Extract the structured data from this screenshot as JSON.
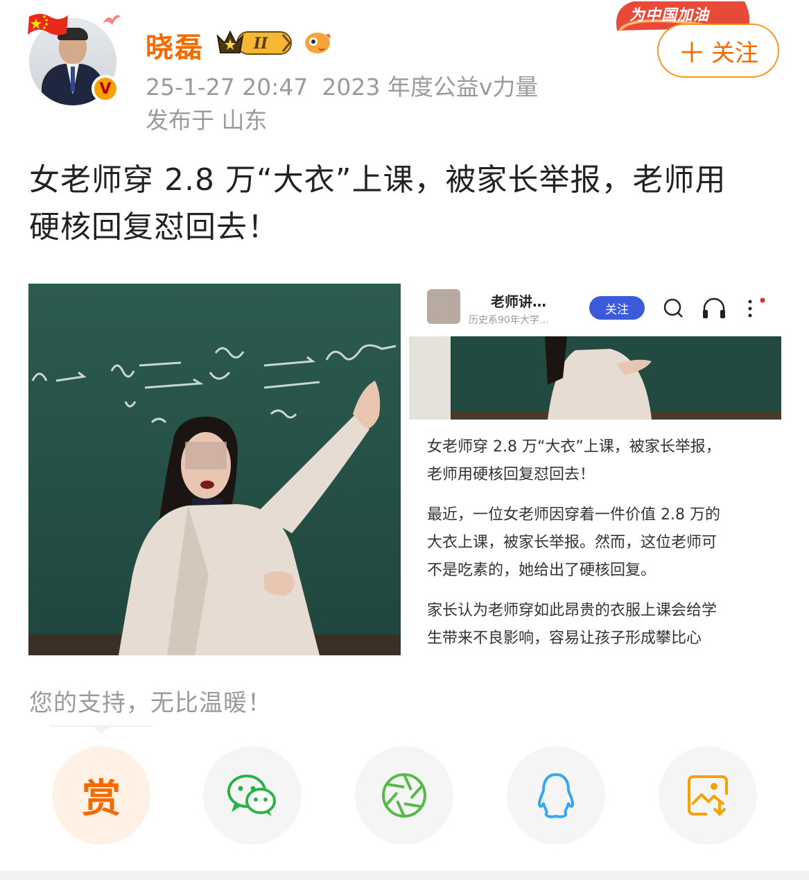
{
  "post": {
    "author": {
      "name": "晓磊",
      "level_badge": "II",
      "timestamp": "25-1-27 20:47",
      "tag": "2023 年度公益v力量",
      "location": "发布于 山东"
    },
    "promo_banner": "为中国加油",
    "follow_label": "关注",
    "title_line1": "女老师穿 2.8 万“大衣”上课，被家长举报，老师用",
    "title_line2": "硬核回复怼回去！"
  },
  "embedded_screenshot": {
    "account_name": "老师讲…",
    "account_sub": "历史系90年大学…",
    "follow_label": "关注",
    "headline_line1": "女老师穿 2.8 万“大衣”上课，被家长举报，",
    "headline_line2": "老师用硬核回复怼回去！",
    "para1_line1": "最近，一位女老师因穿着一件价值 2.8 万的",
    "para1_line2": "大衣上课，被家长举报。然而，这位老师可",
    "para1_line3": "不是吃素的，她给出了硬核回复。",
    "para2_line1": "家长认为老师穿如此昂贵的衣服上课会给学",
    "para2_line2": "生带来不良影响，容易让孩子形成攀比心"
  },
  "support_text": "您的支持，无比温暖！",
  "share": {
    "reward_label": "赏",
    "buttons": [
      "wechat-icon",
      "moments-icon",
      "qq-icon",
      "save-image-icon"
    ]
  },
  "colors": {
    "accent": "#f56a00",
    "follow_border": "#f7931e",
    "wechat": "#2bb34a",
    "moments": "#57b947",
    "qq": "#36a6f0",
    "save": "#f7a100"
  }
}
